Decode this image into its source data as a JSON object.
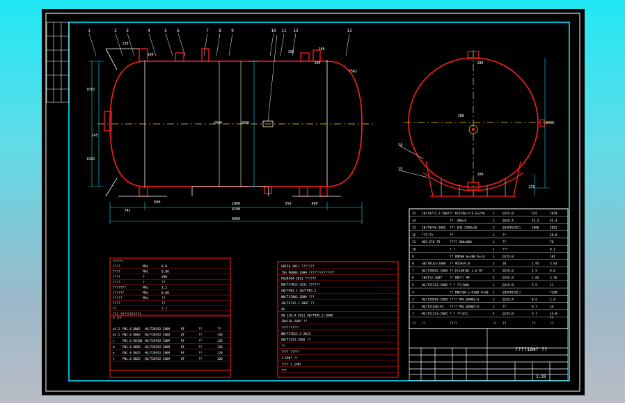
{
  "drawing": {
    "balloons": [
      "1",
      "2",
      "3",
      "4",
      "5",
      "6",
      "7",
      "8",
      "9",
      "10",
      "11",
      "12",
      "13"
    ],
    "side_view_balloons": [
      "14",
      "15"
    ],
    "dims": {
      "overall_length": "6060",
      "cylinder_length": "4100",
      "support_spacing": "1800",
      "left_offset": "741",
      "left_support": "600",
      "right_offset": "550",
      "right_support": "600",
      "nozzle_a": "138",
      "nozzle_b": "100",
      "nozzle_c": "156",
      "nozzle_d": "100",
      "top_e": "180",
      "top_f": "75",
      "vert_left": "1010",
      "vert_left2": "1920",
      "vert_left3": "245",
      "inner_diam": "2400",
      "outer_diam": "2600",
      "head_r": "R2",
      "side_diam": "2400",
      "side_top": "180",
      "side_bottom": "270",
      "side_nozzle": "180",
      "side_low": "100"
    },
    "tech_table_title": "?????",
    "pipe_table_title": "? ??",
    "bom_title": "???????",
    "title_block_name": "????10m? ??",
    "scale": "1:20"
  },
  "tech_rows": [
    [
      "????",
      "MPa",
      "0.8"
    ],
    [
      "????",
      "MPa",
      "0.88"
    ],
    [
      "????",
      "?",
      "200"
    ],
    [
      "????",
      "?",
      "??"
    ],
    [
      "???????",
      "MPa",
      "1.1"
    ],
    [
      "??????",
      "MPa",
      "0.88"
    ],
    [
      "?????",
      "MPa",
      "??"
    ],
    [
      "????",
      "",
      "??"
    ],
    [
      "??",
      "",
      "? ?"
    ],
    [
      "??? ???????????",
      "",
      " "
    ]
  ],
  "pipe_rows": [
    [
      "a1-2",
      "PN1.6 DN65",
      "HG/T20592-2009",
      "RF",
      "??",
      "??"
    ],
    [
      "b1-2",
      "PN1.6 DN65",
      "HG/T20592-2009",
      "RF",
      "??",
      "150"
    ],
    [
      "c",
      "PN1.6 DN100",
      "HG/T20592-2009",
      "RF",
      "??",
      "120"
    ],
    [
      "d",
      "PN1.6 DN50",
      "HG/T20592-2009",
      "RF",
      "??",
      "120"
    ],
    [
      "e",
      "PN1.6 DN25",
      "HG/T20592-2009",
      "RF",
      "??",
      "120"
    ],
    [
      "f",
      "PN1.6 DN25",
      "HG/T20592-2009",
      "RF",
      "??",
      "120"
    ]
  ],
  "spec_rows": [
    "GB150-2011 ???????",
    "TSG R0004-2009 ??????????????",
    "HG20584-2011 ??????",
    "NB/T47015-2011 ??????",
    "GB/T985.1 GB/T985.2",
    "NB/T47003-2009 ???",
    "JB/T4712.1-2007 ??",
    "4X",
    "GB 150.4-2011 GB/T985.2-2008",
    "JB4730-2005 ??",
    "??????????",
    "NB/T47013.2-2015",
    "GB/T3323-2005 ??",
    "??",
    "???? ?????",
    "1.5PN? ??",
    "???? 1.1PN?",
    "???"
  ],
  "bom_rows": [
    [
      "15",
      "JB/T4712.1-2007",
      "?? BI2700-F/S H=250",
      "2",
      "Q235-B",
      "535",
      "1070"
    ],
    [
      "14",
      "",
      "?? -300x4",
      "1",
      "Q235-A",
      "21.2",
      "42.4"
    ],
    [
      "13",
      "JB/T4746-2002",
      "??? EHA 2700x16",
      "2",
      "Q345R(HIC)",
      "1006",
      "2012"
    ],
    [
      "12",
      "??5-73",
      "??",
      "1",
      "??",
      "",
      "19.6"
    ],
    [
      "11",
      "HG5-2?6-79",
      "???? 300x400",
      "1",
      "??",
      "",
      "76"
    ],
    [
      "10",
      "",
      "? ?",
      "1",
      "???",
      "",
      "0.1"
    ],
    [
      "9",
      "",
      "?? DN500 H=300 δ=14",
      "1",
      "Q235-B",
      "",
      "181"
    ],
    [
      "8",
      "GB/T8163-2008",
      "?? Φ159x9.0",
      "2",
      "20",
      "1.95",
      "3.92"
    ],
    [
      "7",
      "HG/T20592-2009",
      "?? PL100(B)-1.6 RF",
      "2",
      "Q235-B",
      "4.5",
      "9.0"
    ],
    [
      "6",
      "JB4712-2007",
      "?? DN??? RF",
      "4",
      "Q235-B",
      "1.65",
      "3.76"
    ],
    [
      "5",
      "HG/T21513-2005",
      "? ?   ??(100)",
      "1",
      "Q235-B",
      "5.5",
      "11"
    ],
    [
      "4",
      "",
      "?? DN2700 L=4100 δ=20",
      "1",
      "Q345R(HIC)",
      "",
      "7168"
    ],
    [
      "3",
      "HG/T20592-2009",
      "???? PN1.6DN65-A",
      "2",
      "Q235-A",
      "0.6",
      "2.4"
    ],
    [
      "2",
      "HG/T21630-91",
      "???? PN1.6DN65-A",
      "2",
      "??",
      "9.7",
      "14"
    ],
    [
      "1",
      "HG/T21513-2005",
      "?  ?   ??(65)",
      "4",
      "Q235-B",
      "3.7",
      "14.8"
    ]
  ],
  "bom_header": [
    "??",
    "??",
    "????",
    "??",
    "??",
    "??",
    "??"
  ],
  "bom_weight_label": "??"
}
